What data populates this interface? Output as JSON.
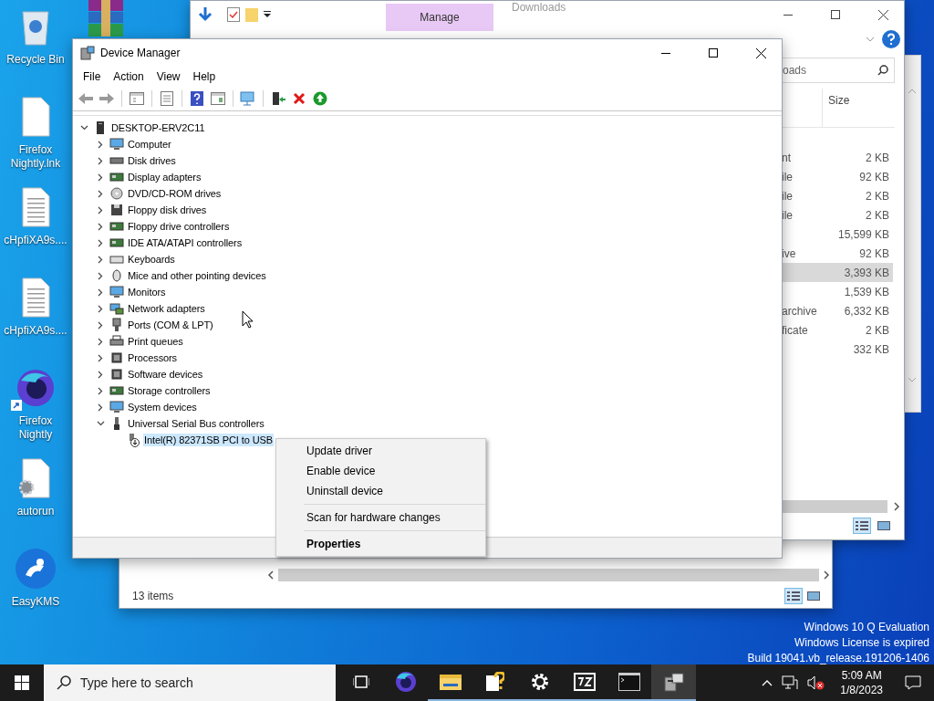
{
  "desktop_icons": [
    {
      "label": "Recycle Bin",
      "shortcut": false
    },
    {
      "label": "Firefox Nightly.lnk",
      "shortcut": false
    },
    {
      "label": "cHpfiXA9s....",
      "shortcut": false
    },
    {
      "label": "cHpfiXA9s....",
      "shortcut": false
    },
    {
      "label": "Firefox Nightly",
      "shortcut": true
    },
    {
      "label": "autorun",
      "shortcut": false
    },
    {
      "label": "EasyKMS",
      "shortcut": false
    }
  ],
  "explorer_back": {
    "status": "13 items"
  },
  "explorer_downloads": {
    "contextual_tab": "Manage",
    "title": "Downloads",
    "search": {
      "value": "oads"
    },
    "columns": [
      "Size"
    ],
    "rows": [
      {
        "type": "nt",
        "size": "2 KB",
        "selected": false
      },
      {
        "type": "ile",
        "size": "92 KB",
        "selected": false
      },
      {
        "type": "ile",
        "size": "2 KB",
        "selected": false
      },
      {
        "type": "ile",
        "size": "2 KB",
        "selected": false
      },
      {
        "size": "15,599 KB",
        "selected": false
      },
      {
        "type": "ive",
        "size": "92 KB",
        "selected": false
      },
      {
        "size": "3,393 KB",
        "selected": true
      },
      {
        "size": "1,539 KB",
        "selected": false
      },
      {
        "type": "archive",
        "size": "6,332 KB",
        "selected": false
      },
      {
        "type": "ficate",
        "size": "2 KB",
        "selected": false
      },
      {
        "size": "332 KB",
        "selected": false
      }
    ]
  },
  "device_manager": {
    "title": "Device Manager",
    "menu": [
      "File",
      "Action",
      "View",
      "Help"
    ],
    "tree": {
      "label": "DESKTOP-ERV2C11",
      "expanded": true,
      "children": [
        {
          "label": "Computer",
          "expanded": false
        },
        {
          "label": "Disk drives",
          "expanded": false
        },
        {
          "label": "Display adapters",
          "expanded": false
        },
        {
          "label": "DVD/CD-ROM drives",
          "expanded": false
        },
        {
          "label": "Floppy disk drives",
          "expanded": false
        },
        {
          "label": "Floppy drive controllers",
          "expanded": false
        },
        {
          "label": "IDE ATA/ATAPI controllers",
          "expanded": false
        },
        {
          "label": "Keyboards",
          "expanded": false
        },
        {
          "label": "Mice and other pointing devices",
          "expanded": false
        },
        {
          "label": "Monitors",
          "expanded": false
        },
        {
          "label": "Network adapters",
          "expanded": false
        },
        {
          "label": "Ports (COM & LPT)",
          "expanded": false
        },
        {
          "label": "Print queues",
          "expanded": false
        },
        {
          "label": "Processors",
          "expanded": false
        },
        {
          "label": "Software devices",
          "expanded": false
        },
        {
          "label": "Storage controllers",
          "expanded": false
        },
        {
          "label": "System devices",
          "expanded": false
        },
        {
          "label": "Universal Serial Bus controllers",
          "expanded": true,
          "children": [
            {
              "label": "Intel(R) 82371SB PCI to USB",
              "selected": true,
              "disabled": true
            }
          ]
        }
      ]
    }
  },
  "context_menu": {
    "items": [
      {
        "kind": "item",
        "label": "Update driver",
        "default": false
      },
      {
        "kind": "item",
        "label": "Enable device",
        "default": false
      },
      {
        "kind": "item",
        "label": "Uninstall device",
        "default": false
      },
      {
        "kind": "separator"
      },
      {
        "kind": "item",
        "label": "Scan for hardware changes",
        "default": false
      },
      {
        "kind": "separator"
      },
      {
        "kind": "item",
        "label": "Properties",
        "default": true
      }
    ]
  },
  "evaluation_notice": [
    "Windows 10 Q Evaluation",
    "Windows License is expired",
    "Build 19041.vb_release.191206-1406"
  ],
  "taskbar": {
    "search": {
      "placeholder": "Type here to search"
    },
    "apps": [
      {
        "running": false,
        "active": false
      },
      {
        "running": false,
        "active": false
      },
      {
        "running": true,
        "active": false
      },
      {
        "running": true,
        "active": false
      },
      {
        "running": true,
        "active": false
      },
      {
        "running": true,
        "active": false
      },
      {
        "running": true,
        "active": false
      },
      {
        "running": true,
        "active": true
      }
    ],
    "clock": {
      "time": "5:09 AM",
      "date": "1/8/2023"
    }
  }
}
